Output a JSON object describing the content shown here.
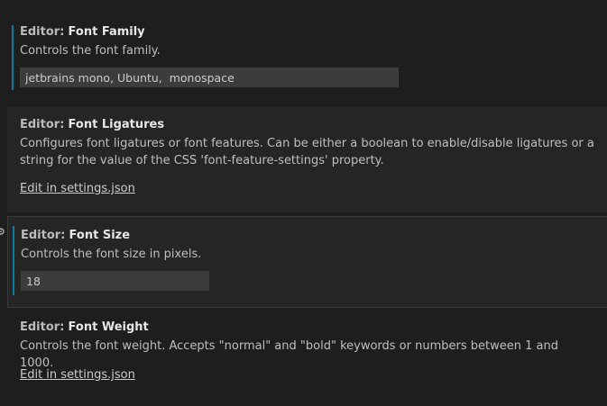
{
  "settings": [
    {
      "category": "Editor:",
      "name": "Font Family",
      "description": "Controls the font family.",
      "value": "jetbrains mono, Ubuntu,  monospace"
    },
    {
      "category": "Editor:",
      "name": "Font Ligatures",
      "description": "Configures font ligatures or font features. Can be either a boolean to enable/disable ligatures or a string for the value of the CSS 'font-feature-settings' property.",
      "link": "Edit in settings.json"
    },
    {
      "category": "Editor:",
      "name": "Font Size",
      "description": "Controls the font size in pixels.",
      "value": "18"
    },
    {
      "category": "Editor:",
      "name": "Font Weight",
      "description": "Controls the font weight. Accepts \"normal\" and \"bold\" keywords or numbers between 1 and 1000.",
      "link": "Edit in settings.json"
    }
  ],
  "icons": {
    "setting_gear": "gear-icon"
  },
  "colors": {
    "background": "#1e1e1e",
    "focused_row": "#252526",
    "input_background": "#3c3c3c",
    "modified_indicator": "#0c7d9d",
    "text": "#cccccc"
  }
}
